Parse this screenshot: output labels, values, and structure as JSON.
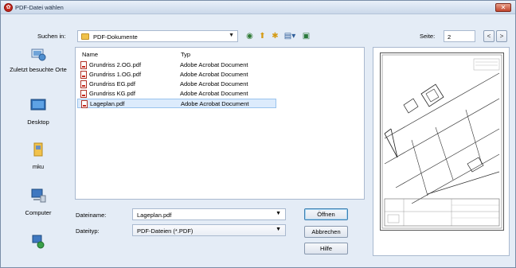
{
  "window": {
    "title": "PDF-Datei wählen"
  },
  "lookin": {
    "label": "Suchen in:",
    "value": "PDF-Dokumente"
  },
  "page": {
    "label": "Seite:",
    "value": "2",
    "prev": "<",
    "next": ">"
  },
  "places": [
    {
      "label": "Zuletzt besuchte Orte",
      "icon": "recent-places-icon"
    },
    {
      "label": "Desktop",
      "icon": "desktop-icon"
    },
    {
      "label": "mku",
      "icon": "user-folder-icon"
    },
    {
      "label": "Computer",
      "icon": "computer-icon"
    },
    {
      "label": "",
      "icon": "network-icon"
    }
  ],
  "file_list": {
    "headers": {
      "name": "Name",
      "type": "Typ"
    },
    "rows": [
      {
        "name": "Grundriss 2.OG.pdf",
        "type": "Adobe Acrobat Document",
        "selected": false
      },
      {
        "name": "Grundriss 1.OG.pdf",
        "type": "Adobe Acrobat Document",
        "selected": false
      },
      {
        "name": "Grundriss EG.pdf",
        "type": "Adobe Acrobat Document",
        "selected": false
      },
      {
        "name": "Grundriss KG.pdf",
        "type": "Adobe Acrobat Document",
        "selected": false
      },
      {
        "name": "Lageplan.pdf",
        "type": "Adobe Acrobat Document",
        "selected": true
      }
    ]
  },
  "filename": {
    "label": "Dateiname:",
    "value": "Lageplan.pdf"
  },
  "filetype": {
    "label": "Dateityp:",
    "value": "PDF-Dateien (*.PDF)"
  },
  "buttons": {
    "open": "Öffnen",
    "cancel": "Abbrechen",
    "help": "Hilfe"
  },
  "colors": {
    "window_bg": "#e4ecf6",
    "selection": "#dcebfc",
    "pdf_red": "#c5291e"
  }
}
